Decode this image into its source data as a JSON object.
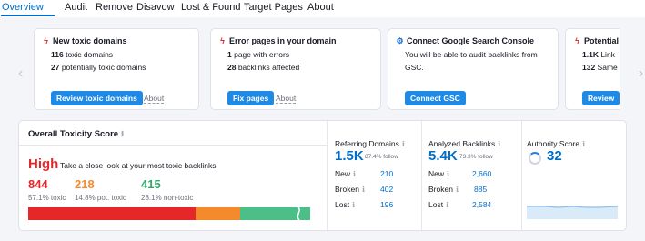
{
  "tabs": [
    "Overview",
    "Audit",
    "Remove",
    "Disavow",
    "Lost & Found",
    "Target Pages",
    "About"
  ],
  "cards": [
    {
      "icon": "bolt-icon",
      "title": "New toxic domains",
      "lines": [
        {
          "strong": "116",
          "text": " toxic domains"
        },
        {
          "strong": "27",
          "text": " potentially toxic domains"
        }
      ],
      "button": "Review toxic domains",
      "about": "About"
    },
    {
      "icon": "bolt-icon",
      "title": "Error pages in your domain",
      "lines": [
        {
          "strong": "1",
          "text": " page with errors"
        },
        {
          "strong": "28",
          "text": " backlinks affected"
        }
      ],
      "button": "Fix pages",
      "about": "About"
    },
    {
      "icon": "gear-icon",
      "title": "Connect Google Search Console",
      "lines": [
        {
          "strong": "",
          "text": "You will be able to audit backlinks from"
        },
        {
          "strong": "",
          "text": "GSC."
        }
      ],
      "button": "Connect GSC"
    },
    {
      "icon": "bolt-icon",
      "title": "Potential",
      "lines": [
        {
          "strong": "1.1K",
          "text": " Link"
        },
        {
          "strong": "132",
          "text": " Same"
        }
      ],
      "button": "Review"
    }
  ],
  "toxicity": {
    "title": "Overall Toxicity Score",
    "info_glyph": "ℹ",
    "level": "High",
    "description": "Take a close look at your most toxic backlinks",
    "toxic": {
      "value": "844",
      "sub": "57.1% toxic",
      "color": "#e5272a"
    },
    "potentially_toxic": {
      "value": "218",
      "sub": "14.8% pot. toxic",
      "color": "#f58a2c"
    },
    "non_toxic": {
      "value": "415",
      "sub": "28.1% non-toxic",
      "color": "#2fa66a"
    }
  },
  "referring_domains": {
    "label": "Referring Domains",
    "value": "1.5K",
    "follow": "87.4% follow",
    "rows": [
      {
        "label": "New",
        "value": "210"
      },
      {
        "label": "Broken",
        "value": "402"
      },
      {
        "label": "Lost",
        "value": "196"
      }
    ]
  },
  "analyzed_backlinks": {
    "label": "Analyzed Backlinks",
    "value": "5.4K",
    "follow": "73.3% follow",
    "rows": [
      {
        "label": "New",
        "value": "2,660"
      },
      {
        "label": "Broken",
        "value": "885"
      },
      {
        "label": "Lost",
        "value": "2,584"
      }
    ]
  },
  "authority_score": {
    "label": "Authority Score",
    "value": "32"
  },
  "colors": {
    "accent": "#006dca",
    "button": "#1f8ae6",
    "alert": "#e5272a",
    "orange": "#f58a2c",
    "green": "#2fa66a"
  }
}
